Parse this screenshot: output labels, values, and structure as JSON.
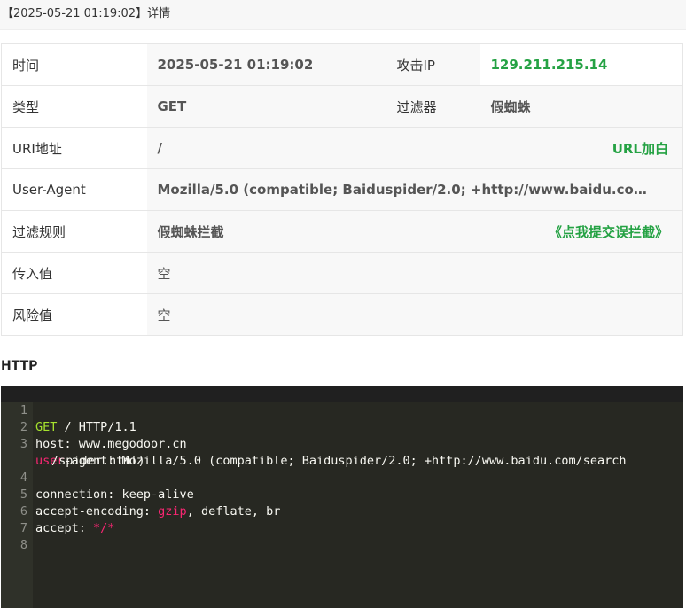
{
  "title": "【2025-05-21 01:19:02】详情",
  "rows": {
    "time_label": "时间",
    "time_value": "2025-05-21 01:19:02",
    "ip_label": "攻击IP",
    "ip_value": "129.211.215.14",
    "type_label": "类型",
    "type_value": "GET",
    "filter_label": "过滤器",
    "filter_value": "假蜘蛛",
    "uri_label": "URI地址",
    "uri_value": "/",
    "uri_action": "URL加白",
    "ua_label": "User-Agent",
    "ua_value": "Mozilla/5.0 (compatible; Baiduspider/2.0; +http://www.baidu.com/search/spider.html)",
    "rule_label": "过滤规则",
    "rule_value": "假蜘蛛拦截",
    "rule_action": "《点我提交误拦截》",
    "input_label": "传入值",
    "input_value": "空",
    "risk_label": "风险值",
    "risk_value": "空"
  },
  "http": {
    "heading": "HTTP",
    "line_numbers": [
      "1",
      "2",
      "3",
      "4",
      "5",
      "6",
      "7",
      "8"
    ],
    "line1": {
      "method": "GET",
      "rest": " / HTTP/1.1"
    },
    "line2": "host: www.megodoor.cn",
    "line3": {
      "key_a": "user",
      "key_b": "-agent: Mozilla/5.0 (compatible; Baiduspider/2.0; +http://www.baidu.com/search"
    },
    "line3_wrap": "/spider.html)",
    "line4": "connection: keep-alive",
    "line5": {
      "key": "accept-encoding: ",
      "gzip": "gzip",
      "rest": ", deflate, br"
    },
    "line6": {
      "key": "accept: ",
      "value": "*/*"
    }
  },
  "colors": {
    "green": "#25a244",
    "editor_bg": "#272822",
    "keyword_green": "#a6e22e",
    "keyword_red": "#f92672"
  }
}
